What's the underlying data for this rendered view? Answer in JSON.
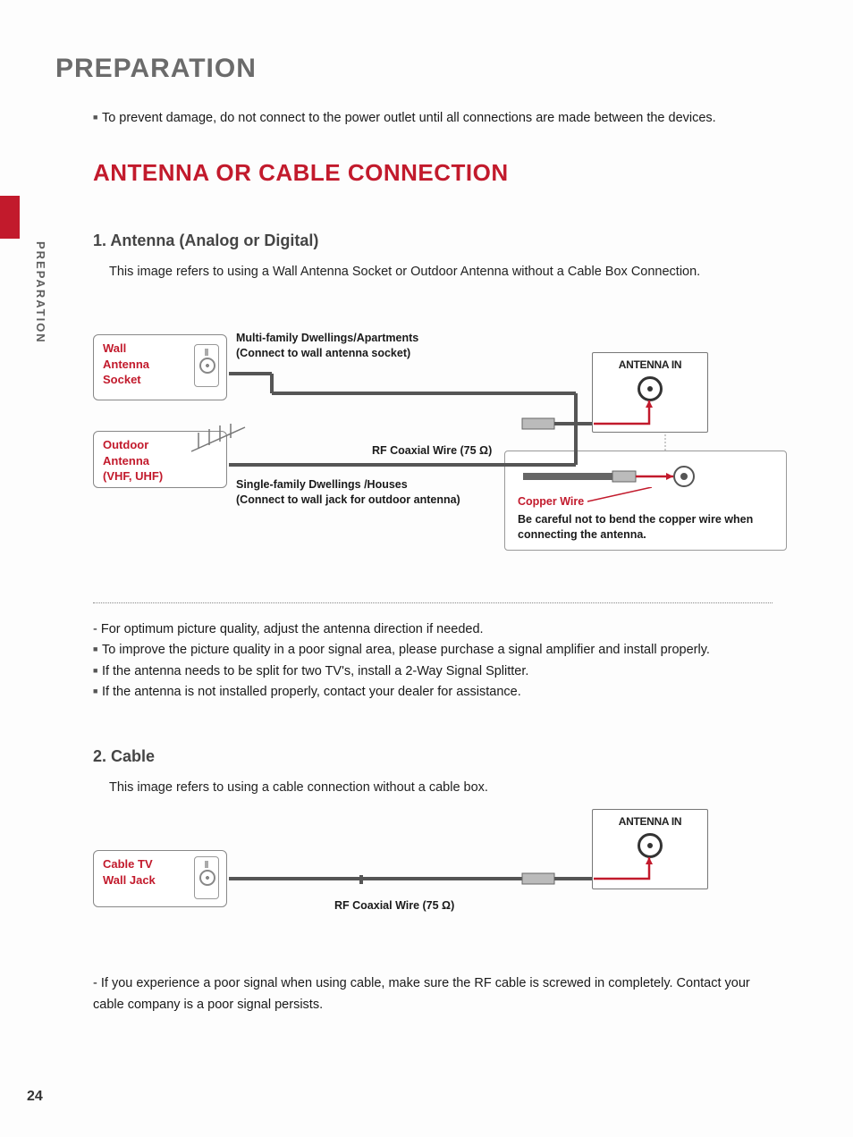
{
  "sideLabel": "PREPARATION",
  "pageTitle": "PREPARATION",
  "pageNumber": "24",
  "preventNote": "To prevent damage, do not connect to the power outlet until all connections are made between the devices.",
  "sectionTitle": "ANTENNA OR CABLE CONNECTION",
  "sectionA": {
    "heading": "1. Antenna (Analog or Digital)",
    "desc": "This image refers to using a Wall Antenna Socket or Outdoor Antenna without a Cable Box Connection.",
    "wallAntennaLabel": "Wall\nAntenna\nSocket",
    "outdoorAntennaLabel": "Outdoor\nAntenna\n(VHF, UHF)",
    "multiLabel": "Multi-family Dwellings/Apartments\n(Connect to wall antenna socket)",
    "singleLabel": "Single-family Dwellings /Houses\n(Connect to wall jack for outdoor antenna)",
    "antennaInLabel": "ANTENNA IN",
    "rfWireLabel": "RF Coaxial Wire (75 Ω)",
    "copperWireLabel": "Copper Wire",
    "copperWarning": "Be careful not to bend the copper wire when connecting the antenna.",
    "notes": [
      "For optimum picture quality, adjust the antenna direction if needed.",
      "To improve the picture quality in a poor signal area, please purchase a signal amplifier and install properly.",
      "If the antenna needs to be split for two TV's, install a 2-Way Signal Splitter.",
      "If the antenna is not installed properly, contact your dealer for assistance."
    ]
  },
  "sectionB": {
    "heading": "2. Cable",
    "desc": "This image refers to using a cable connection without a cable box.",
    "cableTvLabel": "Cable TV\nWall Jack",
    "antennaInLabel": "ANTENNA IN",
    "rfWireLabel": "RF Coaxial Wire (75 Ω)",
    "note": "If you experience a poor signal when using cable, make sure the RF cable is screwed in completely. Contact your cable company is a poor signal persists."
  }
}
